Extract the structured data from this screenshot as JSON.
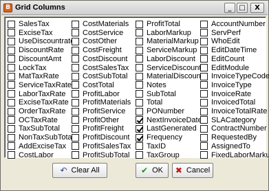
{
  "window": {
    "title": "Grid Columns",
    "icon": "app-icon",
    "controls": {
      "minimize": "_",
      "maximize": "□",
      "close": "X"
    }
  },
  "columns": [
    [
      {
        "label": "SalesTax",
        "checked": false
      },
      {
        "label": "ExciseTax",
        "checked": false
      },
      {
        "label": "UseDiscountrate",
        "checked": false
      },
      {
        "label": "DiscountRate",
        "checked": false
      },
      {
        "label": "DiscountAmt",
        "checked": false
      },
      {
        "label": "LockTax",
        "checked": false
      },
      {
        "label": "MatTaxRate",
        "checked": false
      },
      {
        "label": "ServiceTaxRate",
        "checked": false
      },
      {
        "label": "LaborTaxRate",
        "checked": false
      },
      {
        "label": "ExciseTaxRate",
        "checked": false
      },
      {
        "label": "OrderTaxRate",
        "checked": false
      },
      {
        "label": "OCTaxRate",
        "checked": false
      },
      {
        "label": "TaxSubTotal",
        "checked": false
      },
      {
        "label": "NonTaxSubTotal",
        "checked": false
      },
      {
        "label": "AddExciseTax",
        "checked": false
      },
      {
        "label": "CostLabor",
        "checked": false
      }
    ],
    [
      {
        "label": "CostMaterials",
        "checked": false
      },
      {
        "label": "CostService",
        "checked": false
      },
      {
        "label": "CostOther",
        "checked": false
      },
      {
        "label": "CostFreight",
        "checked": false
      },
      {
        "label": "CostDiscount",
        "checked": false
      },
      {
        "label": "CostSalesTax",
        "checked": false
      },
      {
        "label": "CostSubTotal",
        "checked": false
      },
      {
        "label": "CostTotal",
        "checked": false
      },
      {
        "label": "ProfitLabor",
        "checked": false
      },
      {
        "label": "ProfitMaterials",
        "checked": false
      },
      {
        "label": "ProfitService",
        "checked": false
      },
      {
        "label": "ProfitOther",
        "checked": false
      },
      {
        "label": "ProfitFreight",
        "checked": false
      },
      {
        "label": "ProfitDiscount",
        "checked": false
      },
      {
        "label": "ProfitSalesTax",
        "checked": false
      },
      {
        "label": "ProfitSubTotal",
        "checked": false
      }
    ],
    [
      {
        "label": "ProfitTotal",
        "checked": false
      },
      {
        "label": "LaborMarkup",
        "checked": false
      },
      {
        "label": "MaterialMarkup",
        "checked": false
      },
      {
        "label": "ServiceMarkup",
        "checked": false
      },
      {
        "label": "LaborDiscount",
        "checked": false
      },
      {
        "label": "ServiceDiscount",
        "checked": false
      },
      {
        "label": "MaterialDiscount",
        "checked": false
      },
      {
        "label": "Notes",
        "checked": false
      },
      {
        "label": "SubTotal",
        "checked": false
      },
      {
        "label": "Total",
        "checked": false
      },
      {
        "label": "PONumber",
        "checked": false
      },
      {
        "label": "NextInvoiceDate",
        "checked": true
      },
      {
        "label": "LastGenerated",
        "checked": true
      },
      {
        "label": "Frequency",
        "checked": true
      },
      {
        "label": "TaxID",
        "checked": false
      },
      {
        "label": "TaxGroup",
        "checked": false
      }
    ],
    [
      {
        "label": "AccountNumber",
        "checked": false
      },
      {
        "label": "ServPerf",
        "checked": false
      },
      {
        "label": "WhoEdit",
        "checked": false
      },
      {
        "label": "EditDateTime",
        "checked": false
      },
      {
        "label": "EditCount",
        "checked": false
      },
      {
        "label": "EditModule",
        "checked": false
      },
      {
        "label": "InvoiceTypeCode",
        "checked": false
      },
      {
        "label": "InvoiceType",
        "checked": false
      },
      {
        "label": "InvoiceRate",
        "checked": false
      },
      {
        "label": "InvoicedTotal",
        "checked": false
      },
      {
        "label": "InvoiceTotalRate",
        "checked": false
      },
      {
        "label": "SLACategory",
        "checked": false
      },
      {
        "label": "ContractNumber",
        "checked": false
      },
      {
        "label": "RequestedBy",
        "checked": false
      },
      {
        "label": "AssignedTo",
        "checked": false
      },
      {
        "label": "FixedLaborMarkup",
        "checked": false
      }
    ]
  ],
  "buttons": {
    "clear_all": {
      "label": "Clear All",
      "icon": "undo-arrow-icon"
    },
    "ok": {
      "label": "OK",
      "icon": "checkmark-icon"
    },
    "cancel": {
      "label": "Cancel",
      "icon": "x-mark-icon"
    }
  },
  "colors": {
    "dialog_bg": "#ece9d8",
    "ok_icon": "#1e8c1e",
    "cancel_icon": "#c01818"
  }
}
